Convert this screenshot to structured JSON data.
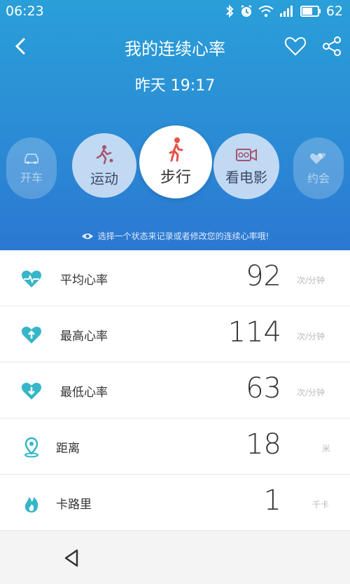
{
  "status_bar": {
    "time": "06:23",
    "battery": "62"
  },
  "header": {
    "title": "我的连续心率",
    "date": "昨天 19:17"
  },
  "modes": [
    {
      "label": "开车"
    },
    {
      "label": "运动"
    },
    {
      "label": "步行"
    },
    {
      "label": "看电影"
    },
    {
      "label": "约会"
    }
  ],
  "hint": "选择一个状态来记录或者修改您的连续心率哦!",
  "stats": [
    {
      "label": "平均心率",
      "value": "92",
      "unit": "次/分钟"
    },
    {
      "label": "最高心率",
      "value": "114",
      "unit": "次/分钟"
    },
    {
      "label": "最低心率",
      "value": "63",
      "unit": "次/分钟"
    },
    {
      "label": "距离",
      "value": "18",
      "unit": "米"
    },
    {
      "label": "卡路里",
      "value": "1",
      "unit": "千卡"
    }
  ],
  "colors": {
    "header_top": "#2a9fd8",
    "header_bottom": "#2b78d2",
    "icon_teal": "#36b6c8",
    "walk_red": "#e8524a"
  },
  "icons": [
    "heart-pulse-icon",
    "heart-up-icon",
    "heart-down-icon",
    "location-icon",
    "flame-icon"
  ]
}
